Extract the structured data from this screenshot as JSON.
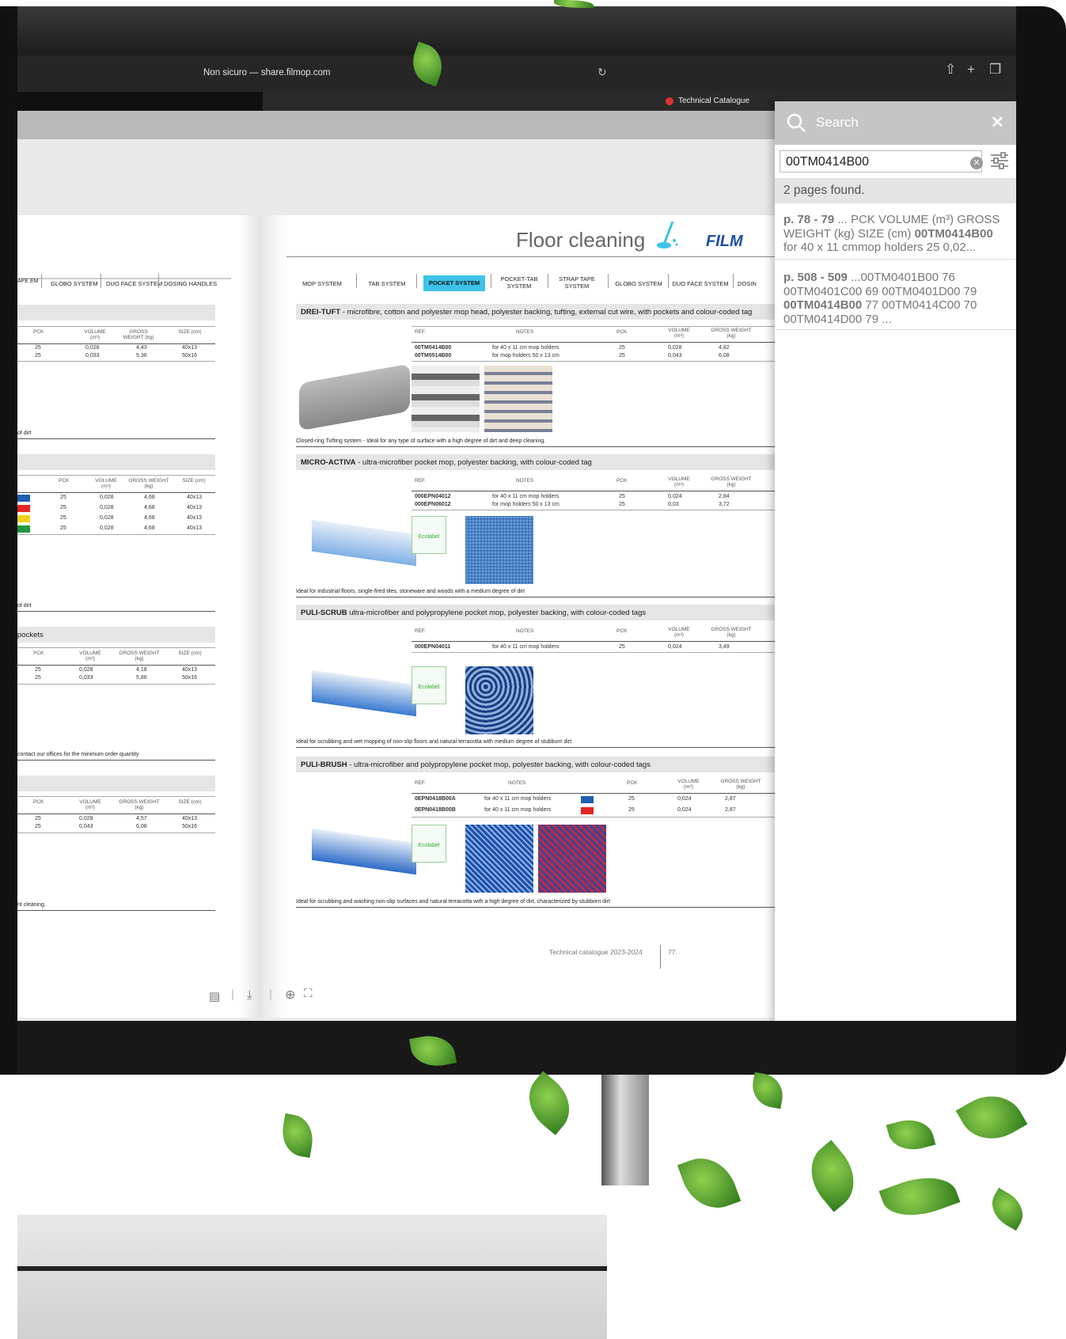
{
  "browser": {
    "url": "Non sicuro — share.filmop.com",
    "tab_title": "Technical Catalogue"
  },
  "search": {
    "title": "Search",
    "query": "00TM0414B00",
    "result_count": "2 pages found.",
    "results": [
      {
        "pages": "p. 78 - 79",
        "pre": " ... PCK VOLUME (m³) GROSS WEIGHT (kg) SIZE (cm) ",
        "hit": "00TM0414B00",
        "post": " for 40 x 11 cmmop holders 25 0,02..."
      },
      {
        "pages": "p. 508 - 509",
        "pre": " ...00TM0401B00 76 00TM0401C00 69 00TM0401D00 79 ",
        "hit": "00TM0414B00",
        "post": " 77 00TM0414C00 70 00TM0414D00 79 ..."
      }
    ]
  },
  "page": {
    "section_title": "Floor cleaning",
    "nav": [
      "MOP SYSTEM",
      "TAB SYSTEM",
      "POCKET SYSTEM",
      "POCKET-TAB SYSTEM",
      "STRAP TAPE SYSTEM",
      "GLOBO SYSTEM",
      "DUO FACE SYSTEM",
      "DOSIN"
    ],
    "left_nav": [
      "APE EM",
      "GLOBO SYSTEM",
      "DUO FACE SYSTEM",
      "DOSING HANDLES"
    ],
    "footer": "Technical catalogue 2023-2024",
    "page_number": "77.",
    "products": [
      {
        "name": "DREI-TUFT",
        "desc": " - microfibre, cotton and polyester mop head, polyester backing, tufting, external cut wire, with pockets and colour-coded tag",
        "headers": [
          "REF.",
          "NOTES",
          "PCK",
          "VOLUME (m³)",
          "GROSS WEIGHT (kg)"
        ],
        "rows": [
          [
            "00TM0414B00",
            "for 40 x 11 cm mop holders",
            "25",
            "0,028",
            "4,82"
          ],
          [
            "00TM0514B00",
            "for mop holders 50 x 13 cm",
            "25",
            "0,043",
            "6,08"
          ]
        ],
        "caption": "Closed-ring Tufting system - Ideal for any type of surface with a high degree of dirt and deep cleaning."
      },
      {
        "name": "MICRO-ACTIVA",
        "desc": " - ultra-microfiber pocket mop, polyester backing, with colour-coded tag",
        "headers": [
          "REF.",
          "NOTES",
          "PCK",
          "VOLUME (m³)",
          "GROSS WEIGHT (kg)"
        ],
        "rows": [
          [
            "000EPN04012",
            "for 40 x 11 cm mop holders",
            "25",
            "0,024",
            "2,84"
          ],
          [
            "000EPN06012",
            "for mop holders 50 x 13 cm",
            "25",
            "0,03",
            "3,72"
          ]
        ],
        "caption": "Ideal for industrial floors, single-fired tiles, stoneware and woods with a medium degree of dirt"
      },
      {
        "name": "PULI-SCRUB",
        "desc": " ultra-microfiber and polypropylene pocket mop, polyester backing, with colour-coded tags",
        "headers": [
          "REF.",
          "NOTES",
          "PCK",
          "VOLUME (m³)",
          "GROSS WEIGHT (kg)"
        ],
        "rows": [
          [
            "000EPN04011",
            "for 40 x 11 cm mop holders",
            "25",
            "0,024",
            "3,49"
          ]
        ],
        "caption": "Ideal for scrubbing and wet mopping of non-slip floors and natural terracotta with medium degree of stubburn dirt"
      },
      {
        "name": "PULI-BRUSH",
        "desc": " - ultra-microfiber and polypropylene pocket mop, polyester backing, with colour-coded tags",
        "headers": [
          "REF.",
          "NOTES",
          "PCK",
          "VOLUME (m³)",
          "GROSS WEIGHT (kg)"
        ],
        "rows": [
          [
            "0EPN0418B00A",
            "for 40 x 11 cm mop holders",
            "25",
            "0,024",
            "2,87"
          ],
          [
            "0EPN0418B00B",
            "for 40 x 11 cm mop holders",
            "25",
            "0,024",
            "2,87"
          ]
        ],
        "caption": "Ideal for scrubbing and washing non-slip surfaces and natural terracotta with a high degree of dirt, characterized by stubborn dirt"
      }
    ],
    "left_tables": {
      "headers": [
        "PCK",
        "VOLUME (m³)",
        "GROSS WEIGHT (kg)",
        "SIZE (cm)"
      ],
      "t1": [
        [
          "25",
          "0,028",
          "4,43",
          "40x13"
        ],
        [
          "25",
          "0,033",
          "5,36",
          "50x16"
        ]
      ],
      "t2": [
        [
          "25",
          "0,028",
          "4,68",
          "40x13"
        ],
        [
          "25",
          "0,028",
          "4,68",
          "40x13"
        ],
        [
          "25",
          "0,028",
          "4,68",
          "40x13"
        ],
        [
          "25",
          "0,028",
          "4,68",
          "40x13"
        ]
      ],
      "t3": [
        [
          "25",
          "0,028",
          "4,18",
          "40x13"
        ],
        [
          "25",
          "0,033",
          "5,86",
          "50x16"
        ]
      ],
      "t4": [
        [
          "25",
          "0,028",
          "4,57",
          "40x13"
        ],
        [
          "25",
          "0,043",
          "6,08",
          "50x16"
        ]
      ],
      "captions": [
        "of dirt",
        "of dirt",
        "pockets",
        "contact our offices for the minimum order quantity",
        "nt cleaning."
      ]
    }
  },
  "colors": {
    "accent": "#3cc2e8",
    "swatch_blue": "#1f5fb0",
    "swatch_red": "#e32521",
    "swatch_yellow": "#f0d21b",
    "swatch_green": "#1e9a3c"
  }
}
